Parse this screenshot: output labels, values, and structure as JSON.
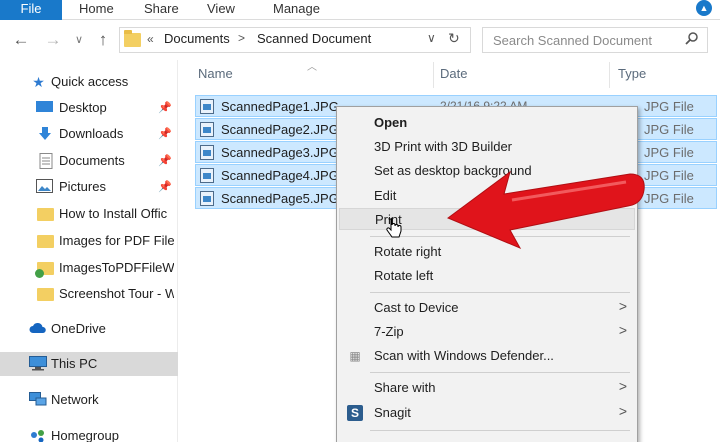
{
  "ribbon": {
    "tabs": [
      "File",
      "Home",
      "Share",
      "View",
      "Manage"
    ]
  },
  "nav": {
    "back": "←",
    "forward": "→",
    "dropdown": "∨",
    "up": "↑"
  },
  "address": {
    "prefix": "«",
    "crumbs": [
      "Documents",
      "Scanned Document"
    ],
    "separator": ">",
    "dropdown": "∨",
    "refresh": "↻"
  },
  "search": {
    "placeholder": "Search Scanned Document"
  },
  "sidebar": {
    "items": [
      {
        "label": "Quick access",
        "icon": "star-icon",
        "pinned": false
      },
      {
        "label": "Desktop",
        "icon": "desktop-icon",
        "pinned": true
      },
      {
        "label": "Downloads",
        "icon": "download-icon",
        "pinned": true
      },
      {
        "label": "Documents",
        "icon": "document-icon",
        "pinned": true
      },
      {
        "label": "Pictures",
        "icon": "pictures-icon",
        "pinned": true
      },
      {
        "label": "How to Install Offic",
        "icon": "folder-icon",
        "pinned": false
      },
      {
        "label": "Images for PDF File",
        "icon": "folder-icon",
        "pinned": false
      },
      {
        "label": "ImagesToPDFFileWi",
        "icon": "folder-sync-icon",
        "pinned": false
      },
      {
        "label": "Screenshot Tour - W",
        "icon": "folder-icon",
        "pinned": false
      },
      {
        "label": "OneDrive",
        "icon": "cloud-icon",
        "pinned": false
      },
      {
        "label": "This PC",
        "icon": "computer-icon",
        "pinned": false,
        "selected": true
      },
      {
        "label": "Network",
        "icon": "network-icon",
        "pinned": false
      },
      {
        "label": "Homegroup",
        "icon": "homegroup-icon",
        "pinned": false
      }
    ]
  },
  "columns": {
    "name": "Name",
    "date": "Date",
    "type": "Type"
  },
  "files": [
    {
      "name": "ScannedPage1.JPG",
      "date": "2/21/16 9:22 AM",
      "type": "JPG File"
    },
    {
      "name": "ScannedPage2.JPG",
      "date": "",
      "type": "JPG File"
    },
    {
      "name": "ScannedPage3.JPG",
      "date": "",
      "type": "JPG File"
    },
    {
      "name": "ScannedPage4.JPG",
      "date": "",
      "type": "JPG File"
    },
    {
      "name": "ScannedPage5.JPG",
      "date": "",
      "type": "JPG File"
    }
  ],
  "context_menu": {
    "items": [
      {
        "label": "Open",
        "bold": true
      },
      {
        "label": "3D Print with 3D Builder"
      },
      {
        "label": "Set as desktop background"
      },
      {
        "label": "Edit"
      },
      {
        "label": "Print",
        "hover": true
      },
      {
        "label": "Rotate right"
      },
      {
        "label": "Rotate left"
      },
      {
        "label": "Cast to Device",
        "submenu": true
      },
      {
        "label": "7-Zip",
        "submenu": true
      },
      {
        "label": "Scan with Windows Defender...",
        "icon": "defender-icon"
      },
      {
        "label": "Share with",
        "submenu": true
      },
      {
        "label": "Snagit",
        "submenu": true,
        "icon": "snagit-icon"
      }
    ],
    "submenu_glyph": ">",
    "snagit_glyph": "S"
  },
  "colors": {
    "accent": "#1979ca",
    "selection": "#cce8ff",
    "selection_border": "#99d1ff",
    "annotation_red": "#e0141b"
  }
}
